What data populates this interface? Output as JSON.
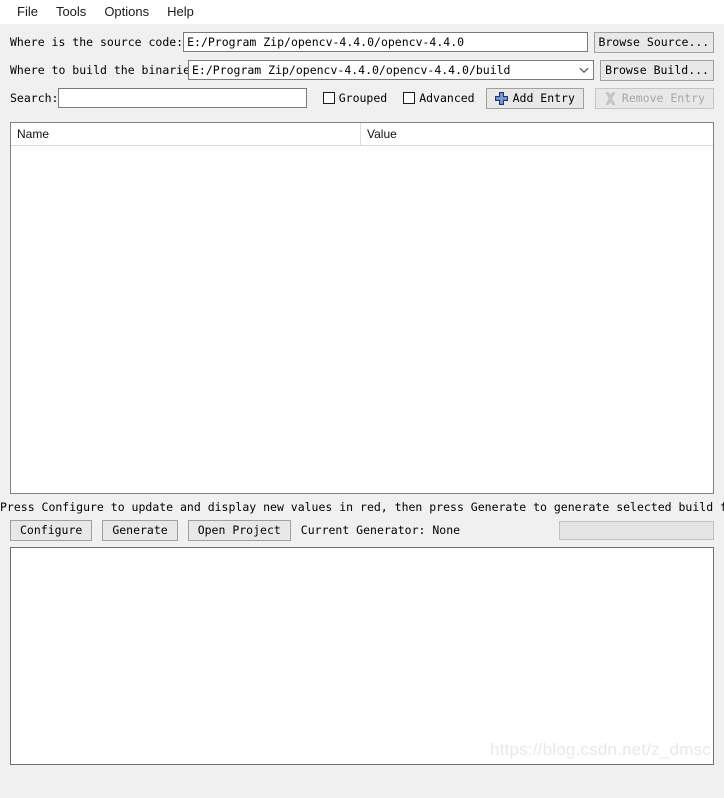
{
  "menu": {
    "items": [
      {
        "label": "File",
        "name": "menu-file"
      },
      {
        "label": "Tools",
        "name": "menu-tools"
      },
      {
        "label": "Options",
        "name": "menu-options"
      },
      {
        "label": "Help",
        "name": "menu-help"
      }
    ]
  },
  "source_row": {
    "label": "Where is the source code:",
    "value": "E:/Program Zip/opencv-4.4.0/opencv-4.4.0",
    "browse_label": "Browse Source..."
  },
  "build_row": {
    "label": "Where to build the binaries:",
    "value": "E:/Program Zip/opencv-4.4.0/opencv-4.4.0/build",
    "browse_label": "Browse Build...",
    "dropdown_icon": "chevron-down-icon"
  },
  "search_row": {
    "label": "Search:",
    "value": "",
    "placeholder": "",
    "grouped_label": "Grouped",
    "grouped_checked": false,
    "advanced_label": "Advanced",
    "advanced_checked": false,
    "add_entry_label": "Add Entry",
    "add_entry_icon": "plus-icon",
    "remove_entry_label": "Remove Entry",
    "remove_entry_icon": "remove-x-icon",
    "remove_entry_disabled": true
  },
  "cache_table": {
    "columns": [
      "Name",
      "Value"
    ],
    "rows": []
  },
  "hint": {
    "text": "Press Configure to update and display new values in red, then press Generate to generate selected build files."
  },
  "actions": {
    "configure_label": "Configure",
    "generate_label": "Generate",
    "open_project_label": "Open Project",
    "current_generator_text": "Current Generator: None",
    "progress_value": 0
  },
  "console": {
    "text": "",
    "watermark": "https://blog.csdn.net/z_dmsc"
  },
  "colors": {
    "window_bg": "#f0f0f0",
    "field_bg": "#ffffff",
    "button_bg": "#e8e8e8",
    "border": "#a0a0a0",
    "accent_plus": "#4a6fb5",
    "disabled_text": "#a6a6a6"
  }
}
